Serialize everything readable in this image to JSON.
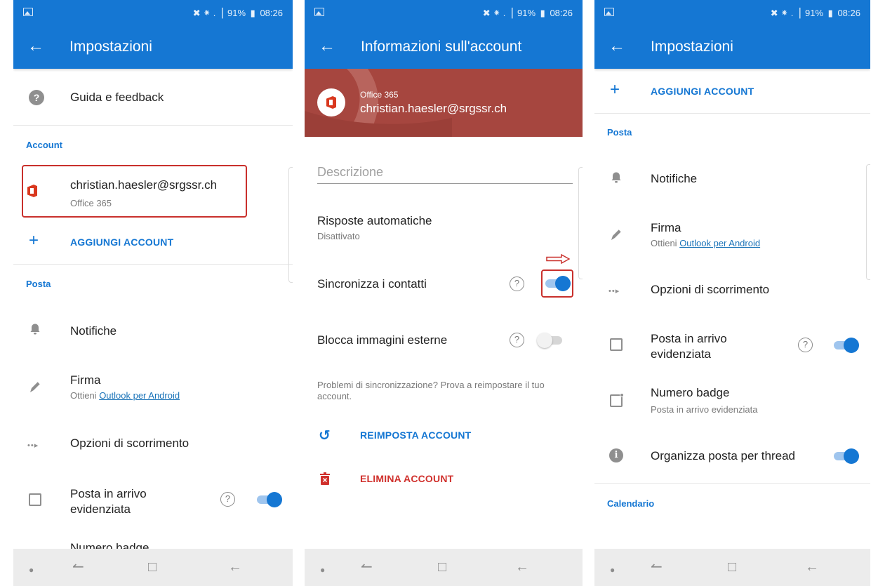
{
  "status": {
    "battery": "91%",
    "time": "08:26",
    "signal_glyphs": "✖ ⁕ .▕"
  },
  "screen1": {
    "title": "Impostazioni",
    "help_label": "Guida e feedback",
    "account_section": "Account",
    "account_email": "christian.haesler@srgssr.ch",
    "account_type": "Office 365",
    "add_account": "AGGIUNGI ACCOUNT",
    "mail_section": "Posta",
    "notifications": "Notifiche",
    "signature_title": "Firma",
    "signature_prefix": "Ottieni ",
    "signature_link": "Outlook per Android",
    "swipe_options": "Opzioni di scorrimento",
    "focused_inbox": "Posta in arrivo evidenziata",
    "badge_number_partial": "Numero badge"
  },
  "screen2": {
    "title": "Informazioni sull'account",
    "account_type": "Office 365",
    "account_email": "christian.haesler@srgssr.ch",
    "description_placeholder": "Descrizione",
    "auto_reply_title": "Risposte automatiche",
    "auto_reply_status": "Disattivato",
    "sync_contacts": "Sincronizza i contatti",
    "block_images": "Blocca immagini esterne",
    "sync_problem_text": "Problemi di sincronizzazione? Prova a reimpostare il tuo account.",
    "reset_account": "REIMPOSTA ACCOUNT",
    "delete_account": "ELIMINA ACCOUNT"
  },
  "screen3": {
    "title": "Impostazioni",
    "add_account": "AGGIUNGI ACCOUNT",
    "mail_section": "Posta",
    "notifications": "Notifiche",
    "signature_title": "Firma",
    "signature_prefix": "Ottieni ",
    "signature_link": "Outlook per Android",
    "swipe_options": "Opzioni di scorrimento",
    "focused_inbox": "Posta in arrivo evidenziata",
    "badge_number": "Numero badge",
    "badge_number_sub": "Posta in arrivo evidenziata",
    "organize_by_thread": "Organizza posta per thread",
    "calendar_section": "Calendario"
  },
  "toggles": {
    "s1_focused_inbox": true,
    "s2_sync_contacts": true,
    "s2_block_images": false,
    "s3_focused_inbox": true,
    "s3_organize_thread": true
  },
  "colors": {
    "brand_blue": "#1577d3",
    "highlight_red": "#c9302c",
    "delete_red": "#d0312d",
    "office_red": "#d9381e",
    "account_header_bg": "#a6463f"
  },
  "icons": {
    "back": "arrow-left-icon",
    "help": "question-circle-icon",
    "add": "plus-icon",
    "bell": "bell-icon",
    "pen": "pen-icon",
    "swipe": "swipe-arrow-icon",
    "inbox": "inbox-icon",
    "badge": "badge-icon",
    "info": "info-icon",
    "reset": "refresh-icon",
    "delete": "trash-icon",
    "office": "office-365-icon"
  }
}
